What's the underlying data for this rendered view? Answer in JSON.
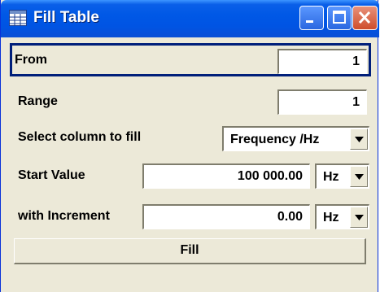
{
  "window": {
    "title": "Fill Table",
    "icon": "table-icon"
  },
  "form": {
    "from": {
      "label": "From",
      "value": "1"
    },
    "range": {
      "label": "Range",
      "value": "1"
    },
    "column": {
      "label": "Select column to fill",
      "value": "Frequency /Hz"
    },
    "start": {
      "label": "Start Value",
      "value": "100 000.00",
      "unit": "Hz"
    },
    "increment": {
      "label": "with Increment",
      "value": "0.00",
      "unit": "Hz"
    }
  },
  "buttons": {
    "fill": "Fill"
  },
  "colors": {
    "titlebar": "#0054e3",
    "panel": "#ece9d8",
    "focus_border": "#001f7a"
  }
}
